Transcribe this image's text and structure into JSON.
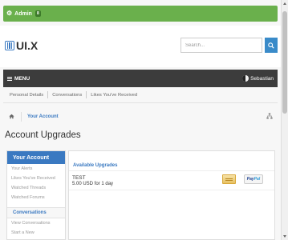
{
  "admin_bar": {
    "label": "Admin",
    "badge": "8"
  },
  "header": {
    "logo_text": "UI.X",
    "search": {
      "placeholder": "Search...",
      "value": ""
    }
  },
  "navbar": {
    "menu_label": "MENU",
    "username": "Sebastian"
  },
  "account_nav": {
    "items": [
      "Personal Details",
      "Conversations",
      "Likes You've Received"
    ]
  },
  "breadcrumb": {
    "current": "Your Account"
  },
  "page_title": "Account Upgrades",
  "sidebar": {
    "section_title": "Your Account",
    "items": [
      "Your Alerts",
      "Likes You've Received",
      "Watched Threads",
      "Watched Forums"
    ],
    "section2_title": "Conversations",
    "section2_items": [
      "View Conversations",
      "Start a New"
    ]
  },
  "upgrades": {
    "heading": "Available Upgrades",
    "items": [
      {
        "title": "TEST",
        "price": "5.00 USD for 1 day",
        "paypal_pay": "Pay",
        "paypal_pal": "Pal"
      }
    ]
  },
  "colors": {
    "admin_bar": "#6ab04c",
    "navbar": "#3c3c3c",
    "accent": "#3a79c1",
    "search_button": "#3a8bc9"
  },
  "icons": {
    "admin": "gear-icon",
    "search": "search-icon",
    "menu": "hamburger-icon",
    "home": "home-icon",
    "sitemap": "sitemap-icon"
  }
}
